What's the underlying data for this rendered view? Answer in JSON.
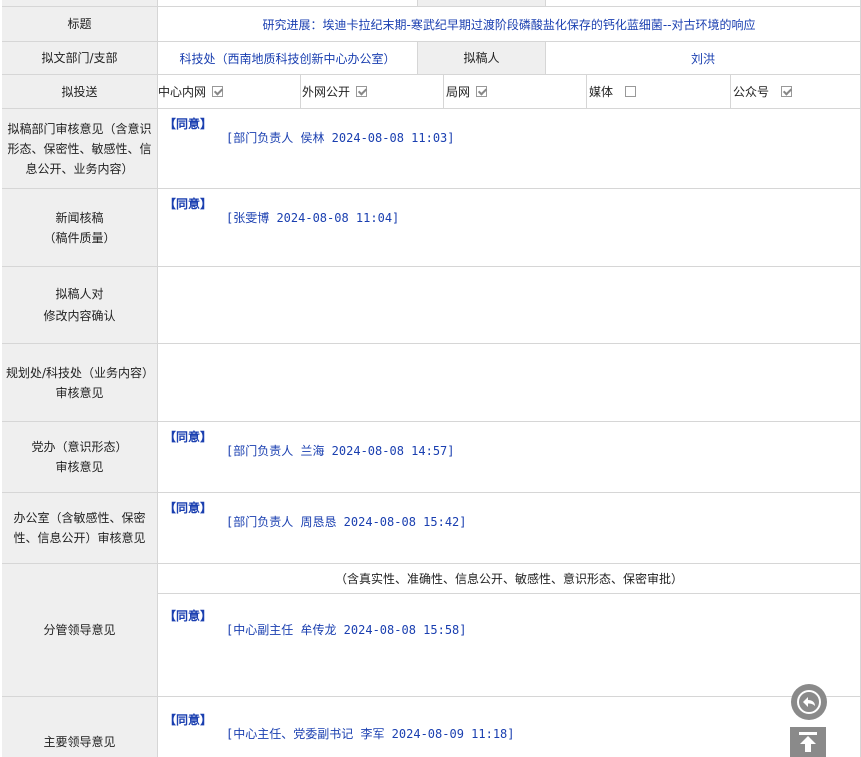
{
  "title_row": {
    "label": "标题",
    "value": "研究进展：埃迪卡拉纪末期-寒武纪早期过渡阶段磷酸盐化保存的钙化蓝细菌--对古环境的响应"
  },
  "dept_row": {
    "label": "拟文部门/支部",
    "value": "科技处（西南地质科技创新中心办公室）",
    "drafter_label": "拟稿人",
    "drafter_value": "刘洪"
  },
  "send_row": {
    "label": "拟投送",
    "options": [
      {
        "label": "中心内网",
        "checked": true
      },
      {
        "label": "外网公开",
        "checked": true
      },
      {
        "label": "局网",
        "checked": true
      },
      {
        "label": "媒体",
        "checked": false
      },
      {
        "label": "公众号",
        "checked": true
      }
    ]
  },
  "dept_review": {
    "label": "拟稿部门审核意见（含意识形态、保密性、敏感性、信息公开、业务内容）",
    "agree": "【同意】",
    "signature": "[部门负责人 侯林 2024-08-08 11:03]"
  },
  "news_review": {
    "label_line1": "新闻核稿",
    "label_line2": "（稿件质量）",
    "agree": "【同意】",
    "signature": "[张雯博 2024-08-08 11:04]"
  },
  "drafter_confirm": {
    "label_line1": "拟稿人对",
    "label_line2": "修改内容确认"
  },
  "planning_review": {
    "label_line1": "规划处/科技处（业务内容）",
    "label_line2": "审核意见"
  },
  "party_review": {
    "label_line1": "党办（意识形态）",
    "label_line2": "审核意见",
    "agree": "【同意】",
    "signature": "[部门负责人 兰海 2024-08-08 14:57]"
  },
  "office_review": {
    "label": "办公室（含敏感性、保密性、信息公开）审核意见",
    "agree": "【同意】",
    "signature": "[部门负责人 周恳恳 2024-08-08 15:42]"
  },
  "leader_review": {
    "label": "分管领导意见",
    "note": "（含真实性、准确性、信息公开、敏感性、意识形态、保密审批）",
    "agree": "【同意】",
    "signature": "[中心副主任 牟传龙 2024-08-08 15:58]"
  },
  "main_leader_review": {
    "label": "主要领导意见",
    "agree": "【同意】",
    "signature": "[中心主任、党委副书记 李军 2024-08-09 11:18]"
  },
  "floating": {
    "back_icon": "reply-arrow-icon",
    "top_icon": "back-to-top-icon"
  }
}
